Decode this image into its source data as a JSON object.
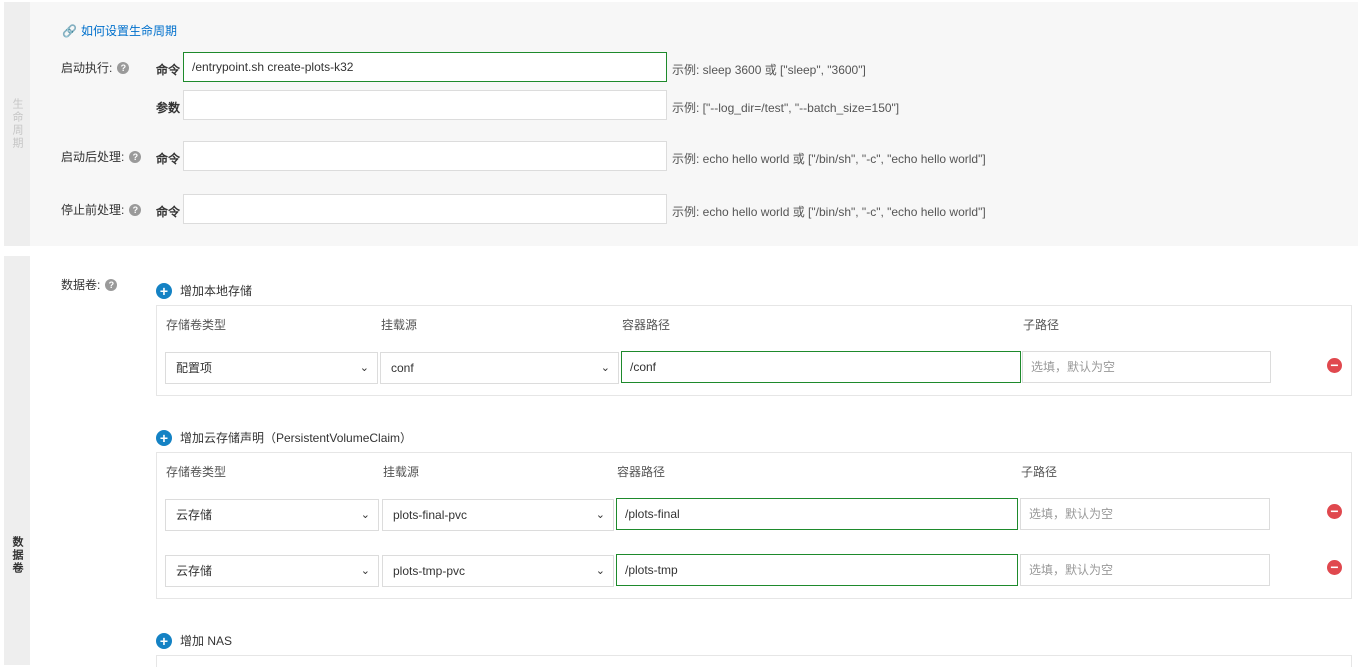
{
  "lifecycle": {
    "side_label": "生命周期",
    "help_link": "如何设置生命周期",
    "startup": {
      "label": "启动执行:",
      "command_label": "命令",
      "command_value": "/entrypoint.sh create-plots-k32",
      "command_hint": "示例: sleep 3600 或 [\"sleep\", \"3600\"]",
      "args_label": "参数",
      "args_value": "",
      "args_hint": "示例: [\"--log_dir=/test\", \"--batch_size=150\"]"
    },
    "post_start": {
      "label": "启动后处理:",
      "command_label": "命令",
      "command_value": "",
      "command_hint": "示例: echo hello world 或 [\"/bin/sh\", \"-c\", \"echo hello world\"]"
    },
    "pre_stop": {
      "label": "停止前处理:",
      "command_label": "命令",
      "command_value": "",
      "command_hint": "示例: echo hello world 或 [\"/bin/sh\", \"-c\", \"echo hello world\"]"
    }
  },
  "volumes": {
    "side_label": "数据卷",
    "label": "数据卷:",
    "local": {
      "add_label": "增加本地存储",
      "headers": [
        "存储卷类型",
        "挂载源",
        "容器路径",
        "子路径"
      ],
      "rows": [
        {
          "type": "配置项",
          "source": "conf",
          "path": "/conf",
          "subpath_placeholder": "选填，默认为空"
        }
      ]
    },
    "pvc": {
      "add_label": "增加云存储声明（PersistentVolumeClaim）",
      "headers": [
        "存储卷类型",
        "挂载源",
        "容器路径",
        "子路径"
      ],
      "rows": [
        {
          "type": "云存储",
          "source": "plots-final-pvc",
          "path": "/plots-final",
          "subpath_placeholder": "选填，默认为空"
        },
        {
          "type": "云存储",
          "source": "plots-tmp-pvc",
          "path": "/plots-tmp",
          "subpath_placeholder": "选填，默认为空"
        }
      ]
    },
    "nas": {
      "add_label": "增加 NAS"
    }
  },
  "colors": {
    "accent": "#0070cc",
    "active_border": "#1e8a2c",
    "remove": "#e0484e",
    "add": "#1482c4"
  }
}
